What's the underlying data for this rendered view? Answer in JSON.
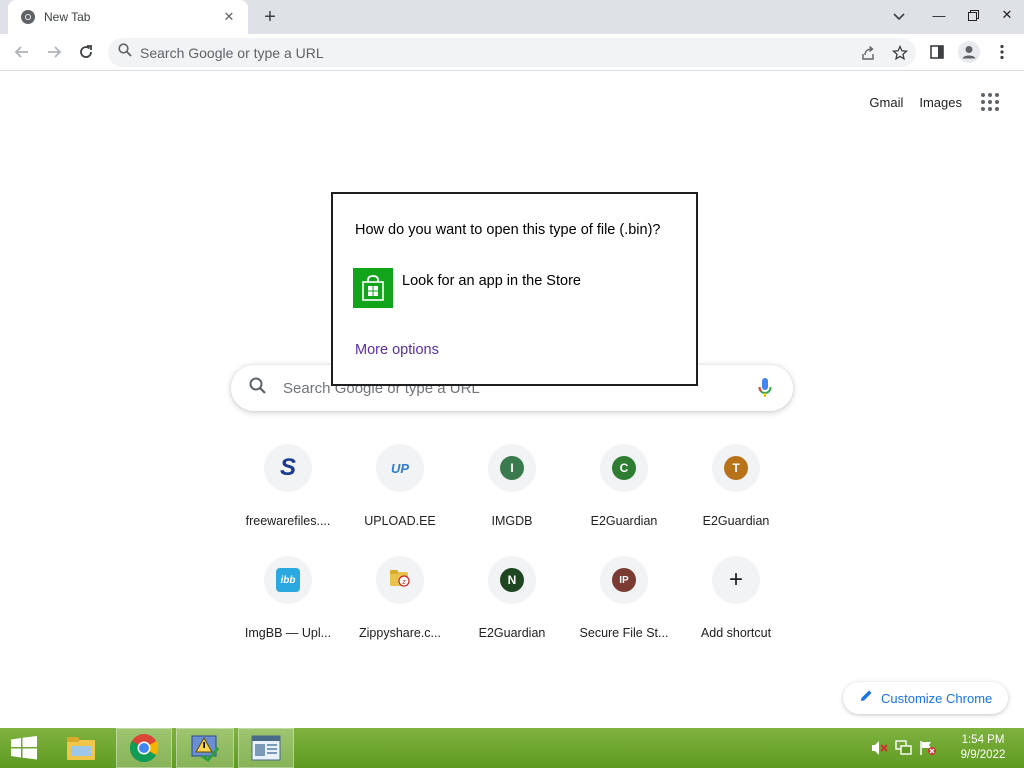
{
  "browser": {
    "tab": {
      "title": "New Tab"
    },
    "omnibox": {
      "placeholder": "Search Google or type a URL"
    }
  },
  "ntp": {
    "top_links": {
      "gmail": "Gmail",
      "images": "Images"
    },
    "search_placeholder": "Search Google or type a URL",
    "shortcuts": [
      {
        "title": "freewarefiles....",
        "icon": "S",
        "icon_color": "#1a3b8f"
      },
      {
        "title": "UPLOAD.EE",
        "icon": "UP",
        "icon_color": "#2d7dd2"
      },
      {
        "title": "IMGDB",
        "icon": "I",
        "icon_color": "#3a7a4e"
      },
      {
        "title": "E2Guardian",
        "icon": "C",
        "icon_color": "#2e7d32"
      },
      {
        "title": "E2Guardian",
        "icon": "T",
        "icon_color": "#b8731a"
      },
      {
        "title": "ImgBB — Upl...",
        "icon": "ibb",
        "icon_color": "#2aa8e0"
      },
      {
        "title": "Zippyshare.c...",
        "icon": "zippy-icon",
        "icon_color": "#e8c34a"
      },
      {
        "title": "E2Guardian",
        "icon": "N",
        "icon_color": "#1e4620"
      },
      {
        "title": "Secure File St...",
        "icon": "IP",
        "icon_color": "#7a3b32"
      },
      {
        "title": "Add shortcut",
        "icon": "+",
        "icon_color": "#202124"
      }
    ],
    "customize_label": "Customize Chrome"
  },
  "dialog": {
    "question": "How do you want to open this type of file (.bin)?",
    "store_option": "Look for an app in the Store",
    "more_options": "More options"
  },
  "taskbar": {
    "time": "1:54 PM",
    "date": "9/9/2022"
  }
}
